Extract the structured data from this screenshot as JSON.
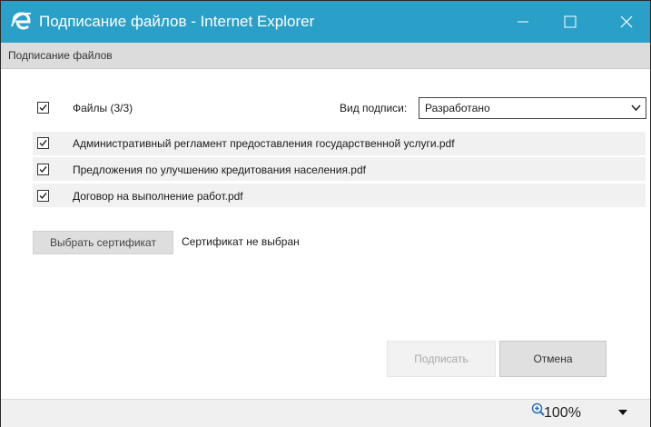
{
  "window": {
    "title": "Подписание файлов - Internet Explorer",
    "accent_color": "#2aa0c8",
    "controls": [
      "minimize-icon",
      "maximize-icon",
      "close-icon"
    ]
  },
  "page_header": {
    "label": "Подписание файлов"
  },
  "files_header": {
    "label": "Файлы (3/3)",
    "checked": true
  },
  "signature_type": {
    "label": "Вид подписи:",
    "value": "Разработано"
  },
  "files": [
    {
      "name": "Административный регламент предоставления государственной услуги.pdf",
      "checked": true
    },
    {
      "name": "Предложения по улучшению кредитования населения.pdf",
      "checked": true
    },
    {
      "name": "Договор на выполнение работ.pdf",
      "checked": true
    }
  ],
  "certificate": {
    "button_label": "Выбрать сертификат",
    "status": "Сертификат не выбран"
  },
  "actions": {
    "sign_label": "Подписать",
    "sign_enabled": false,
    "cancel_label": "Отмена"
  },
  "statusbar": {
    "zoom": "100%"
  }
}
